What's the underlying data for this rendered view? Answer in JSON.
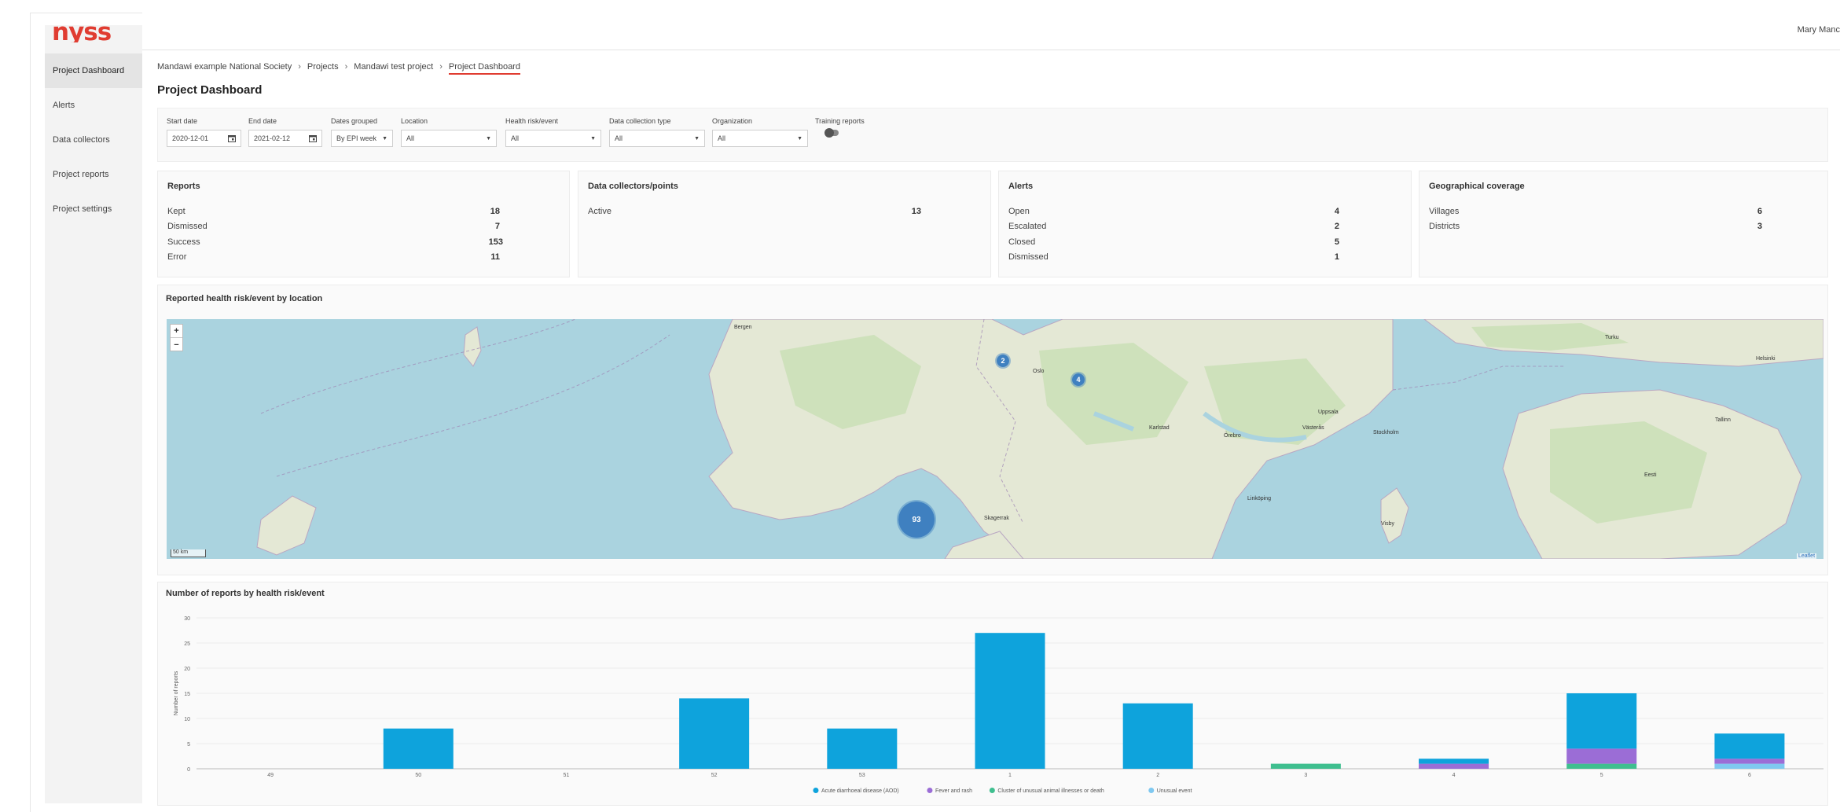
{
  "app": {
    "logo": "nyss",
    "user_name": "Mary Manc"
  },
  "sidebar": {
    "items": [
      {
        "label": "Project Dashboard",
        "active": true
      },
      {
        "label": "Alerts"
      },
      {
        "label": "Data collectors"
      },
      {
        "label": "Project reports"
      },
      {
        "label": "Project settings"
      }
    ]
  },
  "breadcrumb": [
    "Mandawi example National Society",
    "Projects",
    "Mandawi test project",
    "Project Dashboard"
  ],
  "breadcrumb_separator": "›",
  "page_title": "Project Dashboard",
  "filters": {
    "start_date": {
      "label": "Start date",
      "value": "2020-12-01"
    },
    "end_date": {
      "label": "End date",
      "value": "2021-02-12"
    },
    "dates_grouped": {
      "label": "Dates grouped",
      "value": "By EPI week"
    },
    "location": {
      "label": "Location",
      "value": "All"
    },
    "health_risk": {
      "label": "Health risk/event",
      "value": "All"
    },
    "data_collection_type": {
      "label": "Data collection type",
      "value": "All"
    },
    "organization": {
      "label": "Organization",
      "value": "All"
    },
    "training_reports": {
      "label": "Training reports",
      "enabled": false
    }
  },
  "cards": {
    "reports": {
      "title": "Reports",
      "rows": [
        {
          "label": "Kept",
          "value": "18"
        },
        {
          "label": "Dismissed",
          "value": "7"
        },
        {
          "label": "Success",
          "value": "153"
        },
        {
          "label": "Error",
          "value": "11"
        }
      ]
    },
    "data_collectors": {
      "title": "Data collectors/points",
      "rows": [
        {
          "label": "Active",
          "value": "13"
        }
      ]
    },
    "alerts": {
      "title": "Alerts",
      "rows": [
        {
          "label": "Open",
          "value": "4"
        },
        {
          "label": "Escalated",
          "value": "2"
        },
        {
          "label": "Closed",
          "value": "5"
        },
        {
          "label": "Dismissed",
          "value": "1"
        }
      ]
    },
    "geo": {
      "title": "Geographical coverage",
      "rows": [
        {
          "label": "Villages",
          "value": "6"
        },
        {
          "label": "Districts",
          "value": "3"
        }
      ]
    }
  },
  "map": {
    "title": "Reported health risk/event by location",
    "zoom_in": "+",
    "zoom_out": "−",
    "scale_label": "50 km",
    "attribution": "Leaflet",
    "clusters": [
      "2",
      "4",
      "93"
    ],
    "place_labels": [
      "Bergen",
      "Oslo",
      "Stockholm",
      "Tallinn",
      "Helsinki",
      "Skagerrak",
      "Karlstad",
      "Örebro",
      "Västerås",
      "Uppsala",
      "Turku",
      "Visby",
      "Linköping",
      "Eesti"
    ],
    "colors": {
      "water": "#aad3df",
      "land": "#e4e8d5",
      "forest": "#c8dfb4",
      "cluster": "#3f80c0"
    }
  },
  "chart_data": {
    "type": "bar",
    "title": "Number of reports by health risk/event",
    "ylabel": "Number of reports",
    "xlabel": "",
    "ylim": [
      0,
      30
    ],
    "yticks": [
      0,
      5,
      10,
      15,
      20,
      25,
      30
    ],
    "stacked": true,
    "categories": [
      "49",
      "50",
      "51",
      "52",
      "53",
      "1",
      "2",
      "3",
      "4",
      "5",
      "6"
    ],
    "series": [
      {
        "name": "Acute diarrhoeal disease (AOD)",
        "color": "#0ea3dc",
        "values": [
          0,
          8,
          0,
          14,
          8,
          27,
          13,
          0,
          1,
          11,
          5
        ]
      },
      {
        "name": "Fever and rash",
        "color": "#9b6dd6",
        "values": [
          0,
          0,
          0,
          0,
          0,
          0,
          0,
          0,
          1,
          3,
          1
        ]
      },
      {
        "name": "Cluster of unusual animal illnesses or death",
        "color": "#3fbf8f",
        "values": [
          0,
          0,
          0,
          0,
          0,
          0,
          0,
          1,
          0,
          1,
          0
        ]
      },
      {
        "name": "Unusual event",
        "color": "#7fc8f0",
        "values": [
          0,
          0,
          0,
          0,
          0,
          0,
          0,
          0,
          0,
          0,
          1
        ]
      }
    ],
    "legend_position": "bottom",
    "grid": true
  }
}
